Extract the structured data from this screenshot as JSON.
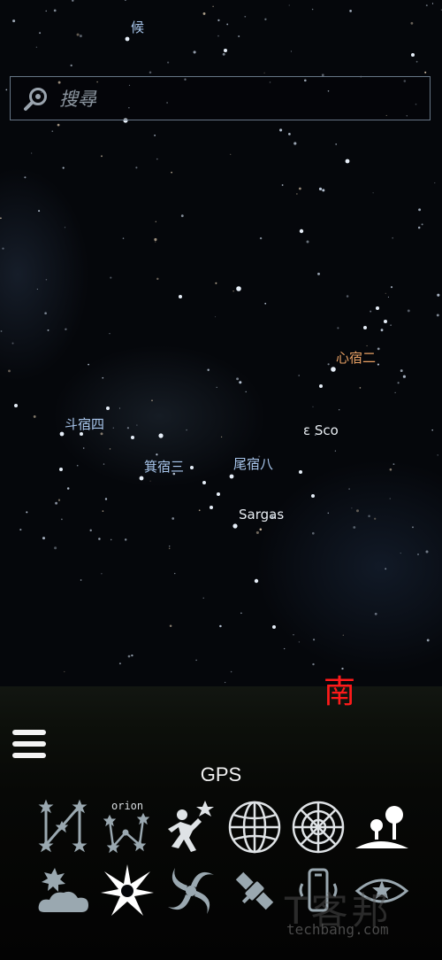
{
  "sky_labels": {
    "hou": "候",
    "dou_su_si": "斗宿四",
    "ji_su_san": "箕宿三",
    "wei_su_ba": "尾宿八",
    "xin_su_er": "心宿二",
    "eps_sco": "ε Sco",
    "sargas": "Sargas"
  },
  "search": {
    "placeholder": "搜尋",
    "icon": "search-icon"
  },
  "compass": {
    "direction": "南",
    "color": "#ff1a1a"
  },
  "menu": {
    "icon": "hamburger-menu-icon"
  },
  "gps_label": "GPS",
  "toolbar": {
    "row1": [
      "constellation-lines-icon",
      "constellation-names-icon",
      "astronaut-icon",
      "grid-globe-icon",
      "polar-grid-icon",
      "landscape-icon"
    ],
    "row2": [
      "atmosphere-icon",
      "bright-star-icon",
      "galaxy-icon",
      "satellite-icon",
      "phone-sensor-icon",
      "eye-icon"
    ]
  },
  "orion_text": "orion",
  "watermark": {
    "text": "techbang.com",
    "cn": "T客邦"
  }
}
